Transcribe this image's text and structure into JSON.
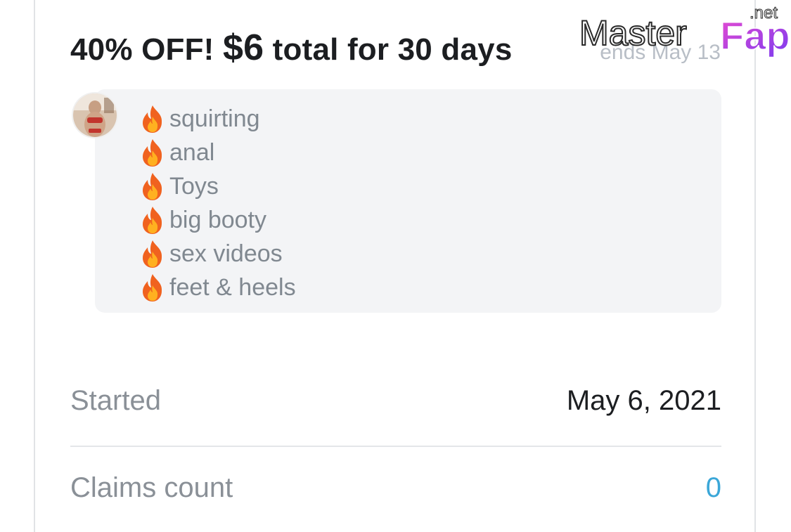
{
  "promo": {
    "title_prefix": "40% OFF!",
    "title_price": "$6",
    "title_suffix": "total for 30 days",
    "ends": "ends May 13"
  },
  "watermark": {
    "text_master": "Master",
    "text_fap": "Fap",
    "text_net": ".net"
  },
  "message": {
    "items": [
      {
        "icon": "fire-emoji",
        "label": "squirting"
      },
      {
        "icon": "fire-emoji",
        "label": "anal"
      },
      {
        "icon": "fire-emoji",
        "label": "Toys"
      },
      {
        "icon": "fire-emoji",
        "label": "big booty"
      },
      {
        "icon": "fire-emoji",
        "label": "sex videos"
      },
      {
        "icon": "fire-emoji",
        "label": "feet & heels"
      }
    ]
  },
  "details": {
    "started_label": "Started",
    "started_value": "May 6, 2021",
    "claims_label": "Claims count",
    "claims_value": "0"
  },
  "colors": {
    "title": "#1c1e21",
    "muted": "#8a9097",
    "link": "#3ba7d8",
    "bubble": "#f3f4f6",
    "watermark_fap": "#b63bd6"
  }
}
